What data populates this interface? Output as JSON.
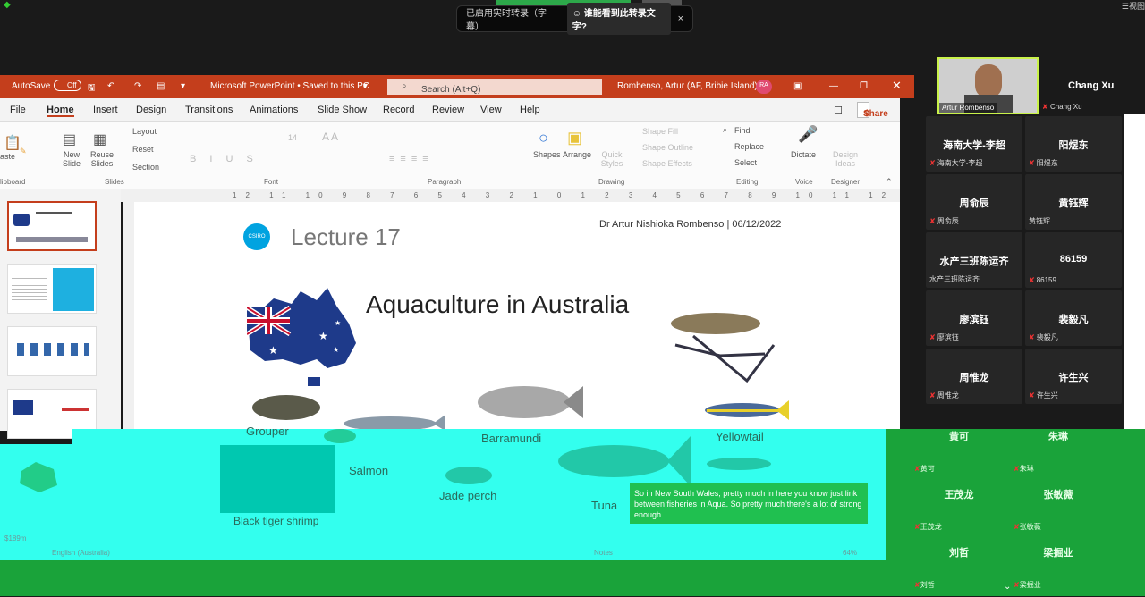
{
  "zoom": {
    "caption_banner": "已启用实时转录（字幕）",
    "caption_question": "谁能看到此转录文字?",
    "close": "×",
    "view_label": "视图"
  },
  "ppt": {
    "autosave": "AutoSave",
    "autosave_state": "Off",
    "title": "Microsoft PowerPoint • Saved to this PC",
    "search": "Search (Alt+Q)",
    "user": "Rombenso, Artur (AF, Bribie Island)",
    "user_initials": "RA",
    "menu": [
      "File",
      "Home",
      "Insert",
      "Design",
      "Transitions",
      "Animations",
      "Slide Show",
      "Record",
      "Review",
      "View",
      "Help"
    ],
    "share": "Share",
    "ribbon": {
      "new_slide": "New Slide",
      "reuse_slides": "Reuse Slides",
      "layout": "Layout",
      "reset": "Reset",
      "section": "Section",
      "shapes": "Shapes",
      "arrange": "Arrange",
      "quick_styles": "Quick Styles",
      "shape_fill": "Shape Fill",
      "shape_outline": "Shape Outline",
      "shape_effects": "Shape Effects",
      "find": "Find",
      "replace": "Replace",
      "select": "Select",
      "dictate": "Dictate",
      "design_ideas": "Design Ideas",
      "paste": "aste",
      "font_size": "14",
      "groups": [
        "lipboard",
        "Slides",
        "Font",
        "Paragraph",
        "Drawing",
        "Editing",
        "Voice",
        "Designer"
      ]
    },
    "ruler": "12 11 10 9 8 7 6 5 4 3 2 1 0 1 2 3 4 5 6 7 8 9 10 11 12",
    "slide": {
      "author_date": "Dr Artur Nishioka Rombenso | 06/12/2022",
      "logo": "CSIRO",
      "lecture": "Lecture 17",
      "title": "Aquaculture in Australia",
      "fish_labels": {
        "grouper": "Grouper",
        "barramundi": "Barramundi",
        "yellowtail": "Yellowtail",
        "salmon": "Salmon",
        "jade_perch": "Jade perch",
        "black_tiger_shrimp": "Black tiger shrimp",
        "tuna": "Tuna"
      }
    },
    "statusbar": {
      "language": "English (Australia)",
      "notes": "Notes",
      "zoom": "64%",
      "thumb_value": "$189m"
    }
  },
  "subtitle": "So in New South Wales, pretty much in here you know just link between fisheries in Aqua. So pretty much there's a lot of strong enough.",
  "participants": {
    "self_name": "Artur Rombenso",
    "host_big": "Chang Xu",
    "host_small": "Chang Xu",
    "tiles": [
      {
        "big": "海南大学-李超",
        "small": "海南大学-李超",
        "muted": true
      },
      {
        "big": "阳煜东",
        "small": "阳煜东",
        "muted": true
      },
      {
        "big": "周俞辰",
        "small": "周俞辰",
        "muted": true
      },
      {
        "big": "黄钰辉",
        "small": "黄钰辉",
        "muted": false
      },
      {
        "big": "水产三班陈运齐",
        "small": "水产三班陈运齐",
        "muted": false
      },
      {
        "big": "86159",
        "small": "86159",
        "muted": true
      },
      {
        "big": "廖滨钰",
        "small": "廖滨钰",
        "muted": true
      },
      {
        "big": "裴毅凡",
        "small": "裴毅凡",
        "muted": true
      },
      {
        "big": "周惟龙",
        "small": "周惟龙",
        "muted": true
      },
      {
        "big": "许生兴",
        "small": "许生兴",
        "muted": true
      }
    ],
    "green_tiles": [
      {
        "big": "黄可",
        "small": "黄可"
      },
      {
        "big": "朱琳",
        "small": "朱琳"
      },
      {
        "big": "王茂龙",
        "small": "王茂龙"
      },
      {
        "big": "张敏薇",
        "small": "张敏薇"
      },
      {
        "big": "刘哲",
        "small": "刘哲"
      },
      {
        "big": "梁掘业",
        "small": "梁掘业"
      }
    ]
  }
}
